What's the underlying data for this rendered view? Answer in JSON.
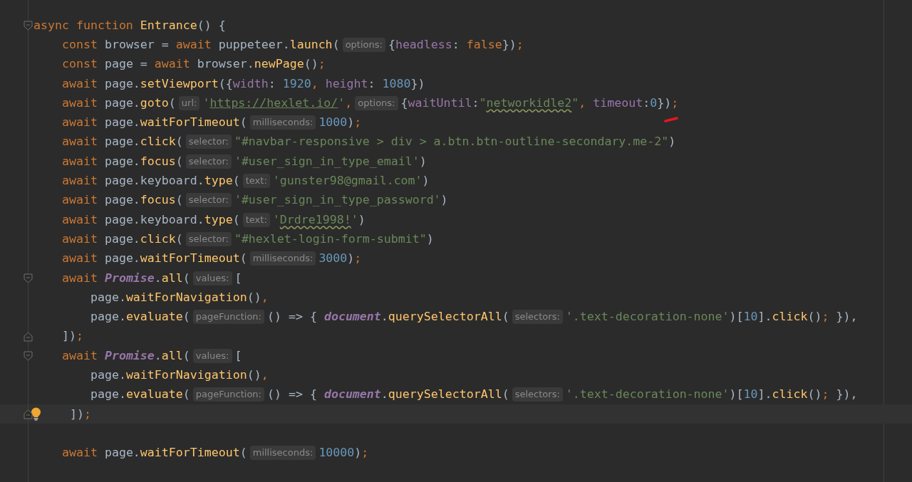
{
  "editor": {
    "lines": [
      {
        "current": false,
        "bulb": false,
        "fold": {
          "kind": "start"
        },
        "tokens": [
          {
            "kind": "keyword",
            "text": "async function "
          },
          {
            "kind": "function",
            "text": "Entrance"
          },
          {
            "kind": "plain",
            "text": "() {"
          }
        ]
      },
      {
        "current": false,
        "bulb": false,
        "tokens": [
          {
            "kind": "keyword",
            "text": "    const "
          },
          {
            "kind": "plain",
            "text": "browser = "
          },
          {
            "kind": "keyword",
            "text": "await "
          },
          {
            "kind": "plain",
            "text": "puppeteer."
          },
          {
            "kind": "function",
            "text": "launch"
          },
          {
            "kind": "plain",
            "text": "("
          },
          {
            "kind": "hint",
            "text": "options:"
          },
          {
            "kind": "plain",
            "text": "{"
          },
          {
            "kind": "property",
            "text": "headless"
          },
          {
            "kind": "plain",
            "text": ": "
          },
          {
            "kind": "keyword",
            "text": "false"
          },
          {
            "kind": "plain",
            "text": "})"
          },
          {
            "kind": "keyword",
            "text": ";"
          }
        ]
      },
      {
        "current": false,
        "bulb": false,
        "tokens": [
          {
            "kind": "keyword",
            "text": "    const "
          },
          {
            "kind": "plain",
            "text": "page = "
          },
          {
            "kind": "keyword",
            "text": "await "
          },
          {
            "kind": "plain",
            "text": "browser."
          },
          {
            "kind": "function",
            "text": "newPage"
          },
          {
            "kind": "plain",
            "text": "()"
          },
          {
            "kind": "keyword",
            "text": ";"
          }
        ]
      },
      {
        "current": false,
        "bulb": false,
        "tokens": [
          {
            "kind": "keyword",
            "text": "    await "
          },
          {
            "kind": "plain",
            "text": "page."
          },
          {
            "kind": "function",
            "text": "setViewport"
          },
          {
            "kind": "plain",
            "text": "({"
          },
          {
            "kind": "property",
            "text": "width"
          },
          {
            "kind": "plain",
            "text": ": "
          },
          {
            "kind": "number",
            "text": "1920"
          },
          {
            "kind": "keyword",
            "text": ", "
          },
          {
            "kind": "property",
            "text": "height"
          },
          {
            "kind": "plain",
            "text": ": "
          },
          {
            "kind": "number",
            "text": "1080"
          },
          {
            "kind": "plain",
            "text": "})"
          }
        ]
      },
      {
        "current": false,
        "bulb": false,
        "tokens": [
          {
            "kind": "keyword",
            "text": "    await "
          },
          {
            "kind": "plain",
            "text": "page."
          },
          {
            "kind": "function",
            "text": "goto"
          },
          {
            "kind": "plain",
            "text": "("
          },
          {
            "kind": "hint",
            "text": "url:"
          },
          {
            "kind": "string",
            "text": "'"
          },
          {
            "kind": "url",
            "text": "https://hexlet.io/"
          },
          {
            "kind": "string",
            "text": "'"
          },
          {
            "kind": "keyword",
            "text": ","
          },
          {
            "kind": "hint",
            "text": "options:"
          },
          {
            "kind": "plain",
            "text": "{"
          },
          {
            "kind": "property",
            "text": "waitUntil"
          },
          {
            "kind": "plain",
            "text": ":"
          },
          {
            "kind": "string",
            "text": "\""
          },
          {
            "kind": "typo",
            "text": "networkidle2"
          },
          {
            "kind": "string",
            "text": "\""
          },
          {
            "kind": "keyword",
            "text": ", "
          },
          {
            "kind": "property",
            "text": "timeout"
          },
          {
            "kind": "plain",
            "text": ":"
          },
          {
            "kind": "number",
            "text": "0"
          },
          {
            "kind": "plain",
            "text": "})"
          },
          {
            "kind": "keyword",
            "text": ";"
          }
        ]
      },
      {
        "current": false,
        "bulb": false,
        "tokens": [
          {
            "kind": "keyword",
            "text": "    await "
          },
          {
            "kind": "plain",
            "text": "page."
          },
          {
            "kind": "function",
            "text": "waitForTimeout"
          },
          {
            "kind": "plain",
            "text": "("
          },
          {
            "kind": "hint",
            "text": "milliseconds:"
          },
          {
            "kind": "number",
            "text": "1000"
          },
          {
            "kind": "plain",
            "text": ")"
          },
          {
            "kind": "keyword",
            "text": ";"
          }
        ]
      },
      {
        "current": false,
        "bulb": false,
        "tokens": [
          {
            "kind": "keyword",
            "text": "    await "
          },
          {
            "kind": "plain",
            "text": "page."
          },
          {
            "kind": "function",
            "text": "click"
          },
          {
            "kind": "plain",
            "text": "("
          },
          {
            "kind": "hint",
            "text": "selector:"
          },
          {
            "kind": "string",
            "text": "\"#navbar-responsive > div > a.btn.btn-outline-secondary.me-2\""
          },
          {
            "kind": "plain",
            "text": ")"
          }
        ]
      },
      {
        "current": false,
        "bulb": false,
        "tokens": [
          {
            "kind": "keyword",
            "text": "    await "
          },
          {
            "kind": "plain",
            "text": "page."
          },
          {
            "kind": "function",
            "text": "focus"
          },
          {
            "kind": "plain",
            "text": "("
          },
          {
            "kind": "hint",
            "text": "selector:"
          },
          {
            "kind": "string",
            "text": "'#user_sign_in_type_email'"
          },
          {
            "kind": "plain",
            "text": ")"
          }
        ]
      },
      {
        "current": false,
        "bulb": false,
        "tokens": [
          {
            "kind": "keyword",
            "text": "    await "
          },
          {
            "kind": "plain",
            "text": "page.keyboard."
          },
          {
            "kind": "function",
            "text": "type"
          },
          {
            "kind": "plain",
            "text": "("
          },
          {
            "kind": "hint",
            "text": "text:"
          },
          {
            "kind": "string",
            "text": "'gunster98@gmail.com'"
          },
          {
            "kind": "plain",
            "text": ")"
          }
        ]
      },
      {
        "current": false,
        "bulb": false,
        "tokens": [
          {
            "kind": "keyword",
            "text": "    await "
          },
          {
            "kind": "plain",
            "text": "page."
          },
          {
            "kind": "function",
            "text": "focus"
          },
          {
            "kind": "plain",
            "text": "("
          },
          {
            "kind": "hint",
            "text": "selector:"
          },
          {
            "kind": "string",
            "text": "'#user_sign_in_type_password'"
          },
          {
            "kind": "plain",
            "text": ")"
          }
        ]
      },
      {
        "current": false,
        "bulb": false,
        "tokens": [
          {
            "kind": "keyword",
            "text": "    await "
          },
          {
            "kind": "plain",
            "text": "page.keyboard."
          },
          {
            "kind": "function",
            "text": "type"
          },
          {
            "kind": "plain",
            "text": "("
          },
          {
            "kind": "hint",
            "text": "text:"
          },
          {
            "kind": "string",
            "text": "'"
          },
          {
            "kind": "typo",
            "text": "Drdre1998!"
          },
          {
            "kind": "string",
            "text": "'"
          },
          {
            "kind": "plain",
            "text": ")"
          }
        ]
      },
      {
        "current": false,
        "bulb": false,
        "tokens": [
          {
            "kind": "keyword",
            "text": "    await "
          },
          {
            "kind": "plain",
            "text": "page."
          },
          {
            "kind": "function",
            "text": "click"
          },
          {
            "kind": "plain",
            "text": "("
          },
          {
            "kind": "hint",
            "text": "selector:"
          },
          {
            "kind": "string",
            "text": "\"#hexlet-login-form-submit\""
          },
          {
            "kind": "plain",
            "text": ")"
          }
        ]
      },
      {
        "current": false,
        "bulb": false,
        "tokens": [
          {
            "kind": "keyword",
            "text": "    await "
          },
          {
            "kind": "plain",
            "text": "page."
          },
          {
            "kind": "function",
            "text": "waitForTimeout"
          },
          {
            "kind": "plain",
            "text": "("
          },
          {
            "kind": "hint",
            "text": "milliseconds:"
          },
          {
            "kind": "number",
            "text": "3000"
          },
          {
            "kind": "plain",
            "text": ")"
          },
          {
            "kind": "keyword",
            "text": ";"
          }
        ]
      },
      {
        "current": false,
        "bulb": false,
        "fold": {
          "kind": "start"
        },
        "tokens": [
          {
            "kind": "keyword",
            "text": "    await "
          },
          {
            "kind": "class",
            "text": "Promise"
          },
          {
            "kind": "plain",
            "text": "."
          },
          {
            "kind": "function",
            "text": "all"
          },
          {
            "kind": "plain",
            "text": "("
          },
          {
            "kind": "hint",
            "text": "values:"
          },
          {
            "kind": "plain",
            "text": "["
          }
        ]
      },
      {
        "current": false,
        "bulb": false,
        "tokens": [
          {
            "kind": "plain",
            "text": "        page."
          },
          {
            "kind": "function",
            "text": "waitForNavigation"
          },
          {
            "kind": "plain",
            "text": "()"
          },
          {
            "kind": "keyword",
            "text": ","
          }
        ]
      },
      {
        "current": false,
        "bulb": false,
        "tokens": [
          {
            "kind": "plain",
            "text": "        page."
          },
          {
            "kind": "function",
            "text": "evaluate"
          },
          {
            "kind": "plain",
            "text": "("
          },
          {
            "kind": "hint",
            "text": "pageFunction:"
          },
          {
            "kind": "plain",
            "text": "() => { "
          },
          {
            "kind": "class",
            "text": "document"
          },
          {
            "kind": "plain",
            "text": "."
          },
          {
            "kind": "function",
            "text": "querySelectorAll"
          },
          {
            "kind": "plain",
            "text": "("
          },
          {
            "kind": "hint",
            "text": "selectors:"
          },
          {
            "kind": "string",
            "text": "'.text-decoration-none'"
          },
          {
            "kind": "plain",
            "text": ")["
          },
          {
            "kind": "number",
            "text": "10"
          },
          {
            "kind": "plain",
            "text": "]."
          },
          {
            "kind": "function",
            "text": "click"
          },
          {
            "kind": "plain",
            "text": "()"
          },
          {
            "kind": "keyword",
            "text": ";"
          },
          {
            "kind": "plain",
            "text": " }),"
          }
        ]
      },
      {
        "current": false,
        "bulb": false,
        "fold": {
          "kind": "end"
        },
        "tokens": [
          {
            "kind": "plain",
            "text": "    ])"
          },
          {
            "kind": "keyword",
            "text": ";"
          }
        ]
      },
      {
        "current": false,
        "bulb": false,
        "fold": {
          "kind": "start"
        },
        "tokens": [
          {
            "kind": "keyword",
            "text": "    await "
          },
          {
            "kind": "class",
            "text": "Promise"
          },
          {
            "kind": "plain",
            "text": "."
          },
          {
            "kind": "function",
            "text": "all"
          },
          {
            "kind": "plain",
            "text": "("
          },
          {
            "kind": "hint",
            "text": "values:"
          },
          {
            "kind": "plain",
            "text": "["
          }
        ]
      },
      {
        "current": false,
        "bulb": false,
        "tokens": [
          {
            "kind": "plain",
            "text": "        page."
          },
          {
            "kind": "function",
            "text": "waitForNavigation"
          },
          {
            "kind": "plain",
            "text": "()"
          },
          {
            "kind": "keyword",
            "text": ","
          }
        ]
      },
      {
        "current": false,
        "bulb": false,
        "tokens": [
          {
            "kind": "plain",
            "text": "        page."
          },
          {
            "kind": "function",
            "text": "evaluate"
          },
          {
            "kind": "plain",
            "text": "("
          },
          {
            "kind": "hint",
            "text": "pageFunction:"
          },
          {
            "kind": "plain",
            "text": "() => { "
          },
          {
            "kind": "class",
            "text": "document"
          },
          {
            "kind": "plain",
            "text": "."
          },
          {
            "kind": "function",
            "text": "querySelectorAll"
          },
          {
            "kind": "plain",
            "text": "("
          },
          {
            "kind": "hint",
            "text": "selectors:"
          },
          {
            "kind": "string",
            "text": "'.text-decoration-none'"
          },
          {
            "kind": "plain",
            "text": ")["
          },
          {
            "kind": "number",
            "text": "10"
          },
          {
            "kind": "plain",
            "text": "]."
          },
          {
            "kind": "function",
            "text": "click"
          },
          {
            "kind": "plain",
            "text": "()"
          },
          {
            "kind": "keyword",
            "text": ";"
          },
          {
            "kind": "plain",
            "text": " }),"
          }
        ]
      },
      {
        "current": true,
        "bulb": true,
        "fold": {
          "kind": "end"
        },
        "tokens": [
          {
            "kind": "plain",
            "text": "    ])"
          },
          {
            "kind": "keyword",
            "text": ";"
          }
        ]
      },
      {
        "current": false,
        "bulb": false
      },
      {
        "current": false,
        "bulb": false,
        "tokens": [
          {
            "kind": "keyword",
            "text": "    await "
          },
          {
            "kind": "plain",
            "text": "page."
          },
          {
            "kind": "function",
            "text": "waitForTimeout"
          },
          {
            "kind": "plain",
            "text": "("
          },
          {
            "kind": "hint",
            "text": "milliseconds:"
          },
          {
            "kind": "number",
            "text": "10000"
          },
          {
            "kind": "plain",
            "text": ")"
          },
          {
            "kind": "keyword",
            "text": ";"
          }
        ]
      }
    ]
  }
}
